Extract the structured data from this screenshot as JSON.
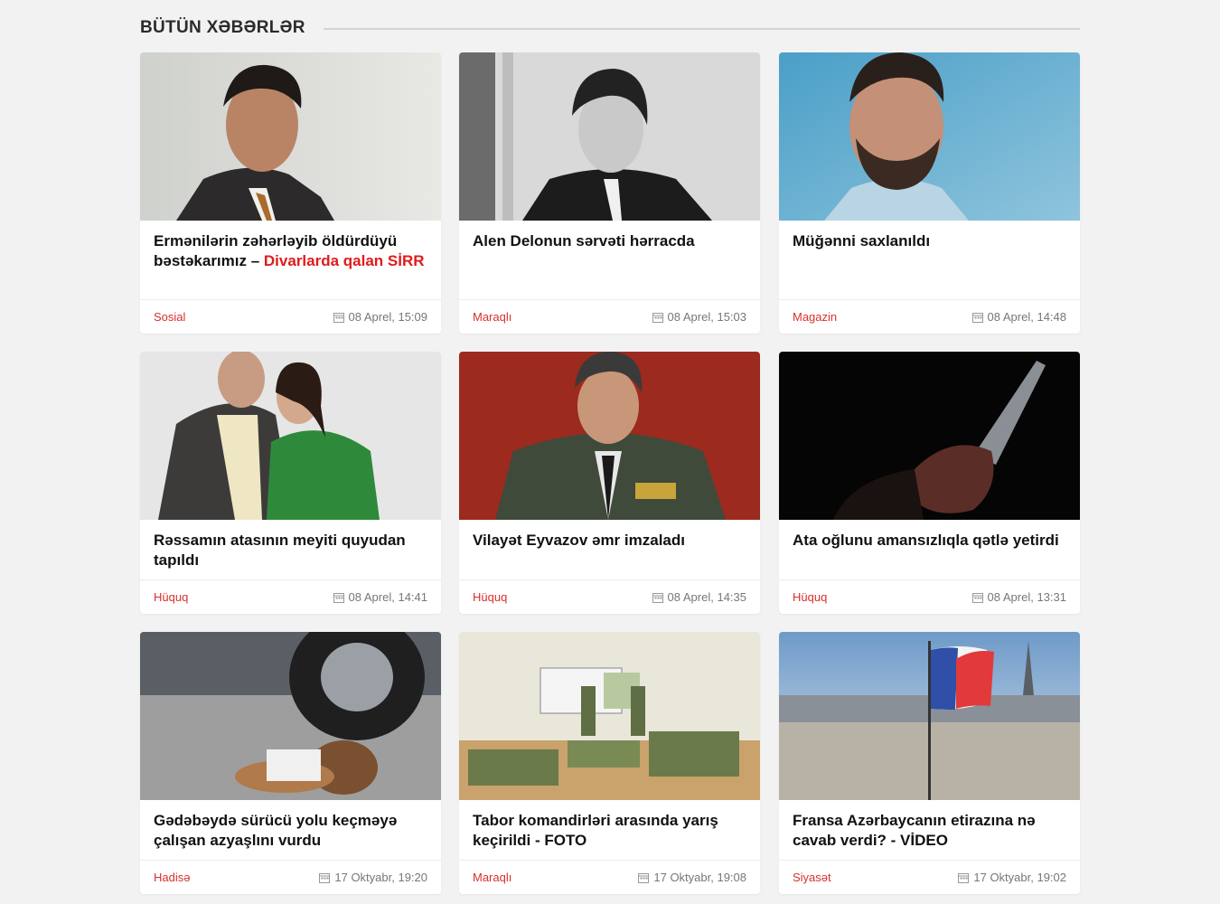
{
  "section": {
    "title": "BÜTÜN XƏBƏRLƏR"
  },
  "cards": [
    {
      "title": "Ermənilərin zəhərləyib öldürdüyü bəstəkarımız – ",
      "title_highlight": "Divarlarda qalan SİRR",
      "category": "Sosial",
      "date": "08 Aprel, 15:09",
      "image": "portrait-color"
    },
    {
      "title": "Alen Delonun sərvəti hərracda",
      "title_highlight": "",
      "category": "Maraqlı",
      "date": "08 Aprel, 15:03",
      "image": "portrait-bw"
    },
    {
      "title": "Müğənni saxlanıldı",
      "title_highlight": "",
      "category": "Magazin",
      "date": "08 Aprel, 14:48",
      "image": "portrait-blue"
    },
    {
      "title": "Rəssamın atasının meyiti quyudan tapıldı",
      "title_highlight": "",
      "category": "Hüquq",
      "date": "08 Aprel, 14:41",
      "image": "couple-photo"
    },
    {
      "title": "Vilayət Eyvazov əmr imzaladı",
      "title_highlight": "",
      "category": "Hüquq",
      "date": "08 Aprel, 14:35",
      "image": "general-portrait"
    },
    {
      "title": "Ata oğlunu amansızlıqla qətlə yetirdi",
      "title_highlight": "",
      "category": "Hüquq",
      "date": "08 Aprel, 13:31",
      "image": "knife-dark"
    },
    {
      "title": "Gədəbəydə sürücü yolu keçməyə çalışan azyaşlını vurdu",
      "title_highlight": "",
      "category": "Hadisə",
      "date": "17 Oktyabr, 19:20",
      "image": "toy-car"
    },
    {
      "title": "Tabor komandirləri arasında yarış keçirildi - FOTO",
      "title_highlight": "",
      "category": "Maraqlı",
      "date": "17 Oktyabr, 19:08",
      "image": "classroom"
    },
    {
      "title": "Fransa Azərbaycanın etirazına nə cavab verdi? - VİDEO",
      "title_highlight": "",
      "category": "Siyasət",
      "date": "17 Oktyabr, 19:02",
      "image": "paris-flag"
    }
  ],
  "colors": {
    "category": "#d9302b",
    "highlight": "#e01b1b",
    "background": "#f2f2f2"
  }
}
